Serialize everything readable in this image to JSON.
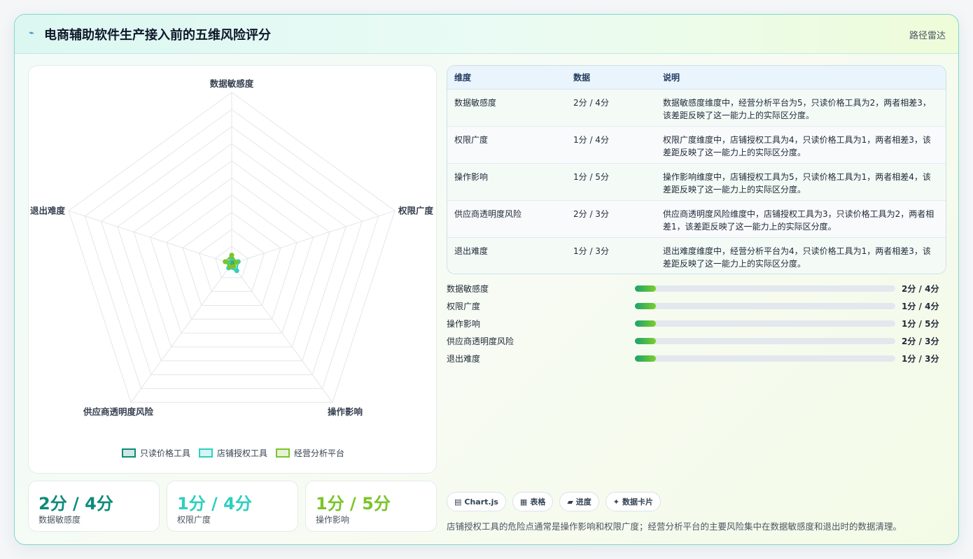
{
  "header": {
    "icon": "lightning-icon",
    "title": "电商辅助软件生产接入前的五维风险评分",
    "tag": "路径雷达"
  },
  "colors": {
    "series1": "#0f8a7a",
    "series2": "#2fcfbf",
    "series3": "#7bc42a"
  },
  "chart_data": {
    "type": "radar",
    "axes": [
      "数据敏感度",
      "权限广度",
      "操作影响",
      "供应商透明度风险",
      "退出难度"
    ],
    "scale_max": 100,
    "rings": 10,
    "legend_position": "bottom",
    "series": [
      {
        "name": "只读价格工具",
        "values": [
          2,
          1,
          1,
          2,
          1
        ]
      },
      {
        "name": "店铺授权工具",
        "values": [
          3,
          4,
          5,
          3,
          2
        ]
      },
      {
        "name": "经营分析平台",
        "values": [
          5,
          3,
          2,
          2,
          4
        ]
      }
    ]
  },
  "stats": [
    {
      "value": "2分 / 4分",
      "label": "数据敏感度"
    },
    {
      "value": "1分 / 4分",
      "label": "权限广度"
    },
    {
      "value": "1分 / 5分",
      "label": "操作影响"
    }
  ],
  "table": {
    "headers": [
      "维度",
      "数据",
      "说明"
    ],
    "rows": [
      {
        "dim": "数据敏感度",
        "data": "2分 / 4分",
        "desc": "数据敏感度维度中，经营分析平台为5，只读价格工具为2，两者相差3，该差距反映了这一能力上的实际区分度。"
      },
      {
        "dim": "权限广度",
        "data": "1分 / 4分",
        "desc": "权限广度维度中，店铺授权工具为4，只读价格工具为1，两者相差3，该差距反映了这一能力上的实际区分度。"
      },
      {
        "dim": "操作影响",
        "data": "1分 / 5分",
        "desc": "操作影响维度中，店铺授权工具为5，只读价格工具为1，两者相差4，该差距反映了这一能力上的实际区分度。"
      },
      {
        "dim": "供应商透明度风险",
        "data": "2分 / 3分",
        "desc": "供应商透明度风险维度中，店铺授权工具为3，只读价格工具为2，两者相差1，该差距反映了这一能力上的实际区分度。"
      },
      {
        "dim": "退出难度",
        "data": "1分 / 3分",
        "desc": "退出难度维度中，经营分析平台为4，只读价格工具为1，两者相差3，该差距反映了这一能力上的实际区分度。"
      }
    ]
  },
  "bars": [
    {
      "name": "数据敏感度",
      "value": "2分 / 4分",
      "fill_pct": 8
    },
    {
      "name": "权限广度",
      "value": "1分 / 4分",
      "fill_pct": 8
    },
    {
      "name": "操作影响",
      "value": "1分 / 5分",
      "fill_pct": 8
    },
    {
      "name": "供应商透明度风险",
      "value": "2分 / 3分",
      "fill_pct": 8
    },
    {
      "name": "退出难度",
      "value": "1分 / 3分",
      "fill_pct": 8
    }
  ],
  "chips": [
    {
      "icon": "chart-icon",
      "glyph": "▤",
      "label": "Chart.js"
    },
    {
      "icon": "table-icon",
      "glyph": "▦",
      "label": "表格"
    },
    {
      "icon": "progress-icon",
      "glyph": "▰",
      "label": "进度"
    },
    {
      "icon": "sparkle-icon",
      "glyph": "✦",
      "label": "数据卡片"
    }
  ],
  "note": "店铺授权工具的危险点通常是操作影响和权限广度；经营分析平台的主要风险集中在数据敏感度和退出时的数据清理。"
}
